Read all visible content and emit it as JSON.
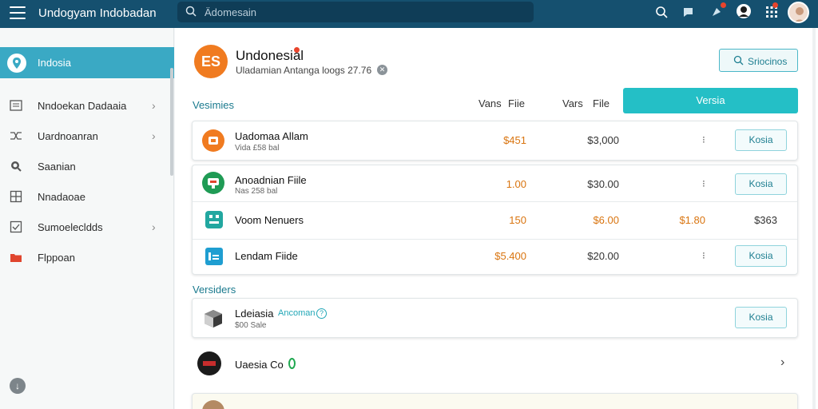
{
  "topbar": {
    "app_title": "Undogyam Indobadan",
    "search_placeholder": "Ädomesain"
  },
  "sidebar": {
    "active_label": "Indosia",
    "items": [
      {
        "label": "Nndoekan Dadaaia",
        "icon": "list-icon",
        "chevron": true
      },
      {
        "label": "Uardnoanran",
        "icon": "shuffle-icon",
        "chevron": true
      },
      {
        "label": "Saanian",
        "icon": "search-icon",
        "chevron": false
      },
      {
        "label": "Nnadaoae",
        "icon": "grid-icon",
        "chevron": false
      },
      {
        "label": "Sumoelecldds",
        "icon": "checklist-icon",
        "chevron": true
      },
      {
        "label": "Flppoan",
        "icon": "folder-icon",
        "chevron": false
      }
    ],
    "bottom_icon": "download-icon"
  },
  "header": {
    "logo_text": "ES",
    "brand": "Undonesial",
    "subline": "Uladamian Antanga loogs 27.76",
    "top_button": "Sriocinos"
  },
  "section1": {
    "title": "Vesimies",
    "col1": "Vans",
    "col2": "Fiie",
    "col3": "Vars",
    "col4": "File",
    "primary_button": "Versia"
  },
  "rows": [
    {
      "name": "Uadomaa Allam",
      "sub": "Vida £58 bal",
      "v1": "$451",
      "v2": "$3,000",
      "btn": "Kosia"
    },
    {
      "name": "Anoadnian Fiile",
      "sub": "Nas 258 bal",
      "v1": "1.00",
      "v2": "$30.00",
      "btn": "Kosia"
    },
    {
      "name": "Voom Nenuers",
      "v1": "150",
      "v2": "$6.00",
      "v3": "$1.80",
      "v4": "$363"
    },
    {
      "name": "Lendam Fiide",
      "v1": "$5.400",
      "v2": "$20.00",
      "btn": "Kosia"
    }
  ],
  "section2": {
    "title": "Versiders",
    "row1": {
      "name": "Ldeiasia",
      "tag": "Ancoman",
      "sub": "$00 Sale",
      "btn": "Kosia"
    },
    "row2": {
      "name": "Uaesia Co"
    }
  },
  "colors": {
    "topbar": "#15506f",
    "accent": "#24bfc6",
    "active_side": "#3aa9c4",
    "orange": "#f07b20"
  }
}
